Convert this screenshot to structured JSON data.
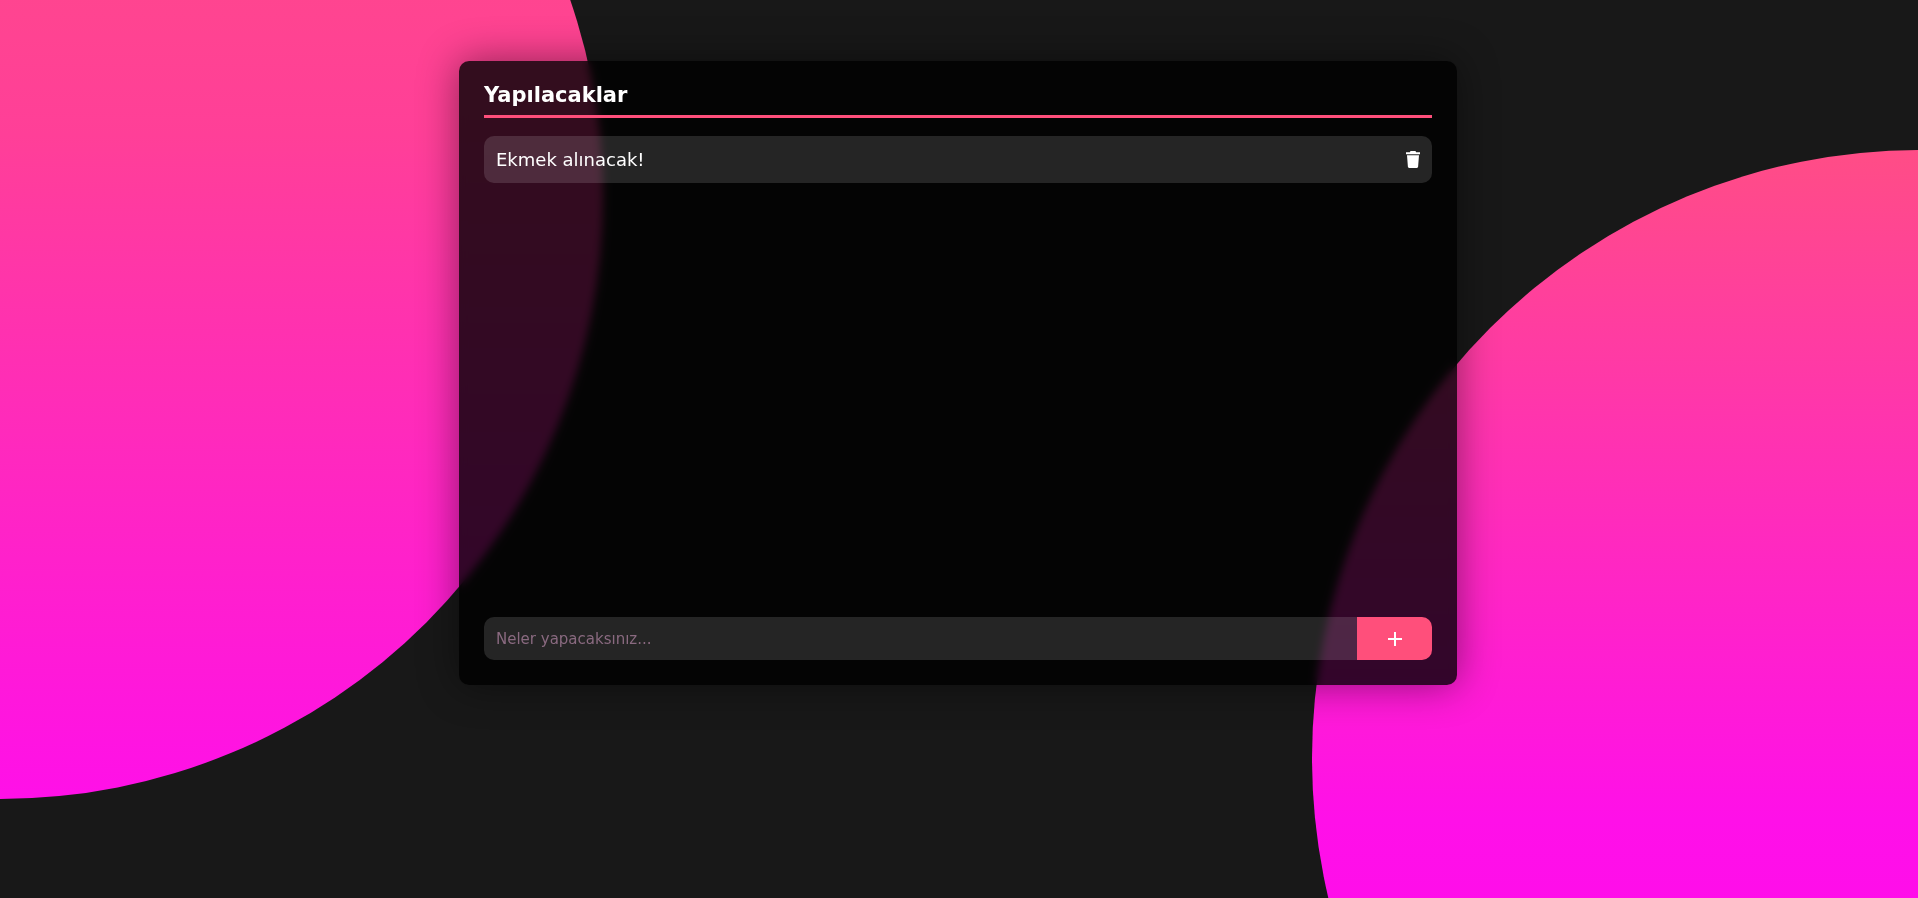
{
  "title": "Yapılacaklar",
  "todos": [
    {
      "text": "Ekmek alınacak!"
    }
  ],
  "new_todo": {
    "placeholder": "Neler yapacaksınız..."
  }
}
